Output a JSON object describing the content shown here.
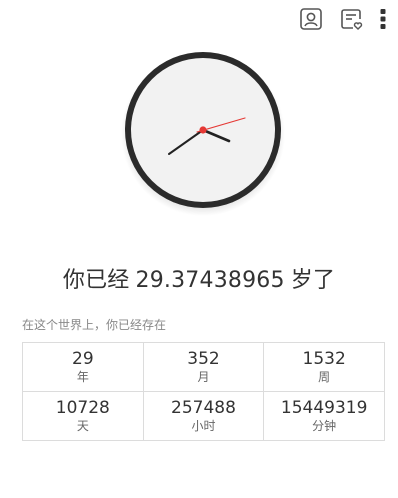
{
  "toolbar": {
    "icons": [
      "profile-icon",
      "saved-heart-icon",
      "more-vertical-icon"
    ]
  },
  "clock": {
    "hour_hand_color": "#222222",
    "minute_hand_color": "#222222",
    "second_hand_color": "#e53935",
    "rim_color": "#2b2b2b",
    "face_color": "#f2f2f2"
  },
  "age": {
    "prefix": "你已经",
    "value": "29.37438965",
    "suffix": "岁了"
  },
  "subtitle": "在这个世界上，你已经存在",
  "stats": [
    {
      "value": "29",
      "unit": "年"
    },
    {
      "value": "352",
      "unit": "月"
    },
    {
      "value": "1532",
      "unit": "周"
    },
    {
      "value": "10728",
      "unit": "天"
    },
    {
      "value": "257488",
      "unit": "小时"
    },
    {
      "value": "15449319",
      "unit": "分钟"
    }
  ]
}
